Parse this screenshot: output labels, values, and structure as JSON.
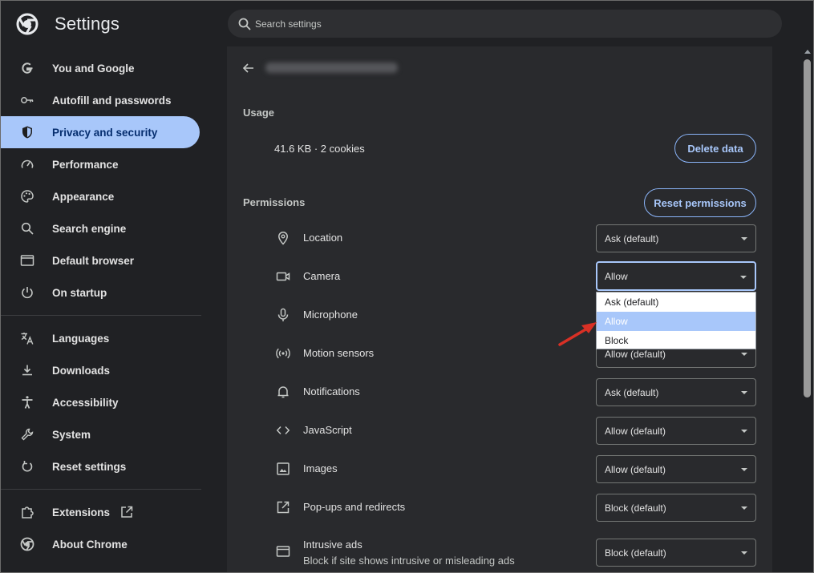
{
  "header": {
    "app_title": "Settings",
    "search_placeholder": "Search settings"
  },
  "sidebar": {
    "items": [
      {
        "label": "You and Google",
        "icon": "google-icon"
      },
      {
        "label": "Autofill and passwords",
        "icon": "key-icon"
      },
      {
        "label": "Privacy and security",
        "icon": "shield-icon",
        "active": true
      },
      {
        "label": "Performance",
        "icon": "speedometer-icon"
      },
      {
        "label": "Appearance",
        "icon": "palette-icon"
      },
      {
        "label": "Search engine",
        "icon": "search-icon"
      },
      {
        "label": "Default browser",
        "icon": "browser-window-icon"
      },
      {
        "label": "On startup",
        "icon": "power-icon"
      },
      {
        "label": "Languages",
        "icon": "translate-icon"
      },
      {
        "label": "Downloads",
        "icon": "download-icon"
      },
      {
        "label": "Accessibility",
        "icon": "accessibility-icon"
      },
      {
        "label": "System",
        "icon": "wrench-icon"
      },
      {
        "label": "Reset settings",
        "icon": "reset-icon"
      },
      {
        "label": "Extensions",
        "icon": "puzzle-icon"
      },
      {
        "label": "About Chrome",
        "icon": "chrome-icon"
      }
    ]
  },
  "main": {
    "usage": {
      "title": "Usage",
      "text": "41.6 KB · 2 cookies",
      "delete_label": "Delete data"
    },
    "permissions": {
      "title": "Permissions",
      "reset_label": "Reset permissions",
      "items": [
        {
          "label": "Location",
          "value": "Ask (default)",
          "icon": "location-pin-icon"
        },
        {
          "label": "Camera",
          "value": "Allow",
          "icon": "camera-icon"
        },
        {
          "label": "Microphone",
          "value": "",
          "icon": "microphone-icon"
        },
        {
          "label": "Motion sensors",
          "value": "Allow (default)",
          "icon": "motion-sensor-icon"
        },
        {
          "label": "Notifications",
          "value": "Ask (default)",
          "icon": "bell-icon"
        },
        {
          "label": "JavaScript",
          "value": "Allow (default)",
          "icon": "code-icon"
        },
        {
          "label": "Images",
          "value": "Allow (default)",
          "icon": "image-icon"
        },
        {
          "label": "Pop-ups and redirects",
          "value": "Block (default)",
          "icon": "popup-icon"
        },
        {
          "label": "Intrusive ads",
          "sublabel": "Block if site shows intrusive or misleading ads",
          "value": "Block (default)",
          "icon": "ads-icon"
        }
      ]
    },
    "dropdown": {
      "options": [
        "Ask (default)",
        "Allow",
        "Block"
      ],
      "highlighted": "Allow"
    }
  },
  "colors": {
    "accent": "#a8c7fa",
    "background": "#202124",
    "panel": "#292a2d",
    "annotation_arrow": "#d93025"
  }
}
